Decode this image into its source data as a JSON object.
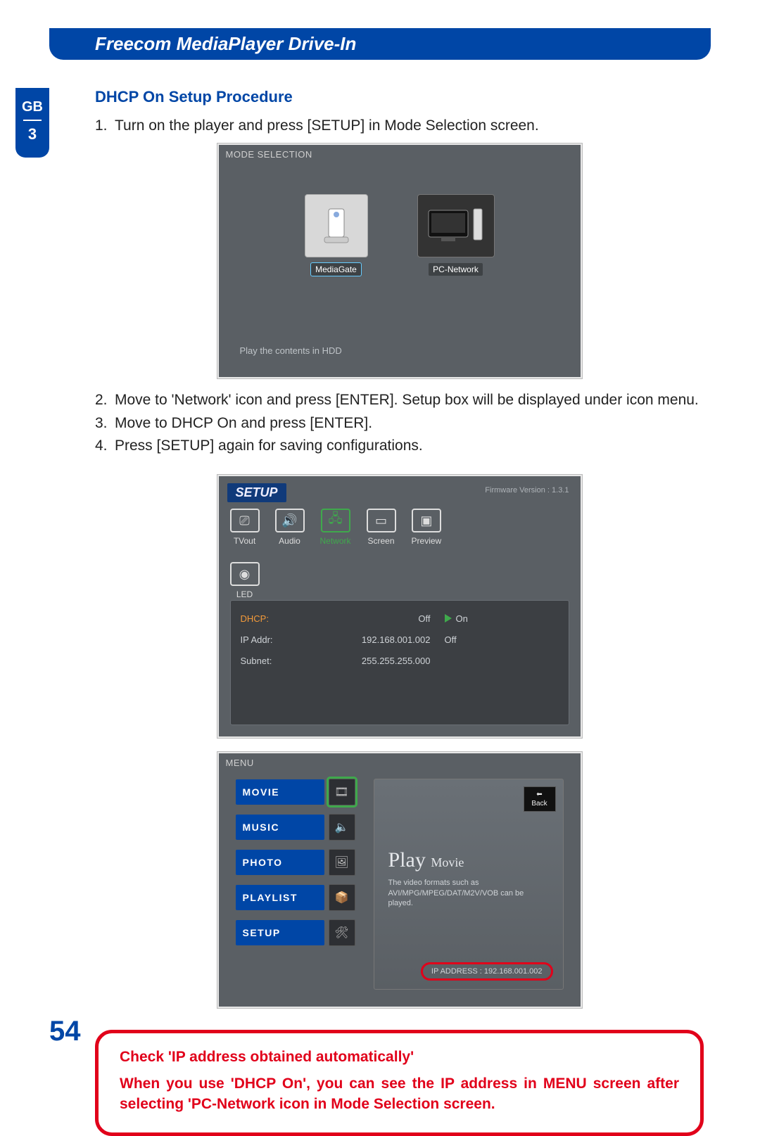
{
  "header": {
    "title": "Freecom MediaPlayer Drive-In"
  },
  "sideTab": {
    "lang": "GB",
    "chapter": "3"
  },
  "section": {
    "title": "DHCP On Setup Procedure"
  },
  "steps": {
    "s1": "Turn on the player and press [SETUP] in Mode Selection screen.",
    "s2": "Move to 'Network' icon and press [ENTER]. Setup box will be displayed under icon menu.",
    "s3": "Move to DHCP On and press [ENTER].",
    "s4": "Press [SETUP] again for saving configurations."
  },
  "modeSelection": {
    "title": "MODE SELECTION",
    "icons": {
      "mediagate": "MediaGate",
      "pcnetwork": "PC-Network"
    },
    "status": "Play the contents in HDD"
  },
  "setup": {
    "title": "SETUP",
    "firmware": "Firmware Version : 1.3.1",
    "tabs": {
      "tvout": "TVout",
      "audio": "Audio",
      "network": "Network",
      "screen": "Screen",
      "preview": "Preview",
      "led": "LED"
    },
    "rows": {
      "dhcp_label": "DHCP:",
      "dhcp_val": "Off",
      "dhcp_on": "On",
      "dhcp_off": "Off",
      "ip_label": "IP Addr:",
      "ip_val": "192.168.001.002",
      "subnet_label": "Subnet:",
      "subnet_val": "255.255.255.000"
    }
  },
  "menu": {
    "title": "MENU",
    "items": {
      "movie": "MOVIE",
      "music": "MUSIC",
      "photo": "PHOTO",
      "playlist": "PLAYLIST",
      "setup": "SETUP"
    },
    "back": "Back",
    "preview_title": "Play",
    "preview_sub": "Movie",
    "preview_desc": "The video formats such as AVI/MPG/MPEG/DAT/M2V/VOB can be played.",
    "ip_line": "IP ADDRESS : 192.168.001.002"
  },
  "warning": {
    "title": "Check 'IP address obtained automatically'",
    "body": "When you use 'DHCP On', you can see the IP address in MENU screen after selecting 'PC-Network icon in Mode Selection screen."
  },
  "pageNumber": "54"
}
